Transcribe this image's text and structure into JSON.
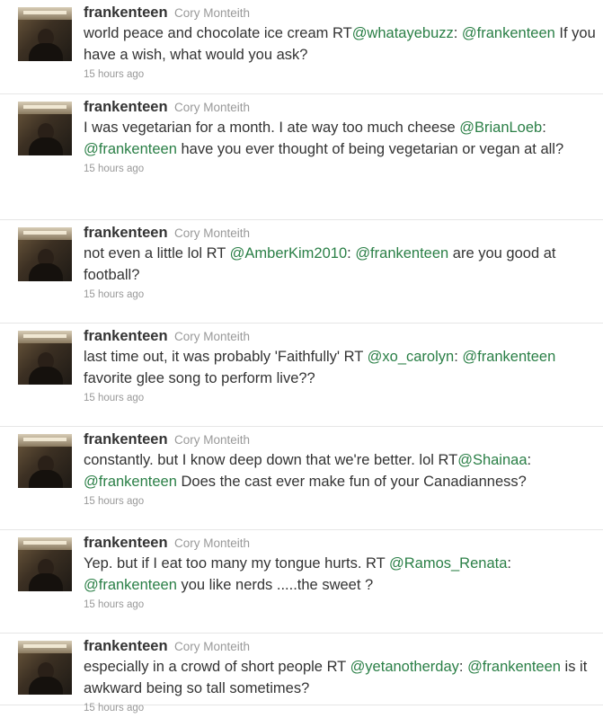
{
  "timeline": {
    "tweets": [
      {
        "screen_name": "frankenteen",
        "full_name": "Cory Monteith",
        "segments": [
          {
            "t": "world peace and chocolate ice cream RT"
          },
          {
            "t": "@whatayebuzz",
            "m": true
          },
          {
            "t": ": "
          },
          {
            "t": "@frankenteen",
            "m": true
          },
          {
            "t": " If you have a wish, what would you ask?"
          }
        ],
        "time": "15 hours ago"
      },
      {
        "screen_name": "frankenteen",
        "full_name": "Cory Monteith",
        "segments": [
          {
            "t": "I was vegetarian for a month. I ate way too much cheese "
          },
          {
            "t": "@BrianLoeb",
            "m": true
          },
          {
            "t": ": "
          },
          {
            "t": "@frankenteen",
            "m": true
          },
          {
            "t": " have you ever thought of being vegetarian or vegan at all?"
          }
        ],
        "time": "15 hours ago"
      },
      {
        "screen_name": "frankenteen",
        "full_name": "Cory Monteith",
        "segments": [
          {
            "t": "not even a little lol RT "
          },
          {
            "t": "@AmberKim2010",
            "m": true
          },
          {
            "t": ": "
          },
          {
            "t": "@frankenteen",
            "m": true
          },
          {
            "t": " are you good at football?"
          }
        ],
        "time": "15 hours ago"
      },
      {
        "screen_name": "frankenteen",
        "full_name": "Cory Monteith",
        "segments": [
          {
            "t": "last time out, it was probably 'Faithfully' RT "
          },
          {
            "t": "@xo_carolyn",
            "m": true
          },
          {
            "t": ": "
          },
          {
            "t": "@frankenteen",
            "m": true
          },
          {
            "t": " favorite glee song to perform live??"
          }
        ],
        "time": "15 hours ago"
      },
      {
        "screen_name": "frankenteen",
        "full_name": "Cory Monteith",
        "segments": [
          {
            "t": "constantly. but I know deep down that we're better. lol RT"
          },
          {
            "t": "@Shainaa",
            "m": true
          },
          {
            "t": ": "
          },
          {
            "t": "@frankenteen",
            "m": true
          },
          {
            "t": " Does the cast ever make fun of your Canadianness?"
          }
        ],
        "time": "15 hours ago"
      },
      {
        "screen_name": "frankenteen",
        "full_name": "Cory Monteith",
        "segments": [
          {
            "t": "Yep. but if I eat too many my tongue hurts. RT "
          },
          {
            "t": "@Ramos_Renata",
            "m": true
          },
          {
            "t": ": "
          },
          {
            "t": "@frankenteen",
            "m": true
          },
          {
            "t": " you like nerds .....the sweet ?"
          }
        ],
        "time": "15 hours ago"
      },
      {
        "screen_name": "frankenteen",
        "full_name": "Cory Monteith",
        "segments": [
          {
            "t": "especially in a crowd of short people RT "
          },
          {
            "t": "@yetanotherday",
            "m": true
          },
          {
            "t": ": "
          },
          {
            "t": "@frankenteen",
            "m": true
          },
          {
            "t": " is it awkward being so tall sometimes?"
          }
        ],
        "time": "15 hours ago"
      }
    ]
  },
  "colors": {
    "mention": "#2a7f46",
    "screen_name": "#333333",
    "full_name": "#999999",
    "timestamp": "#999999",
    "divider": "#e6e6e6"
  },
  "icons": {
    "avatar": "profile-photo"
  }
}
